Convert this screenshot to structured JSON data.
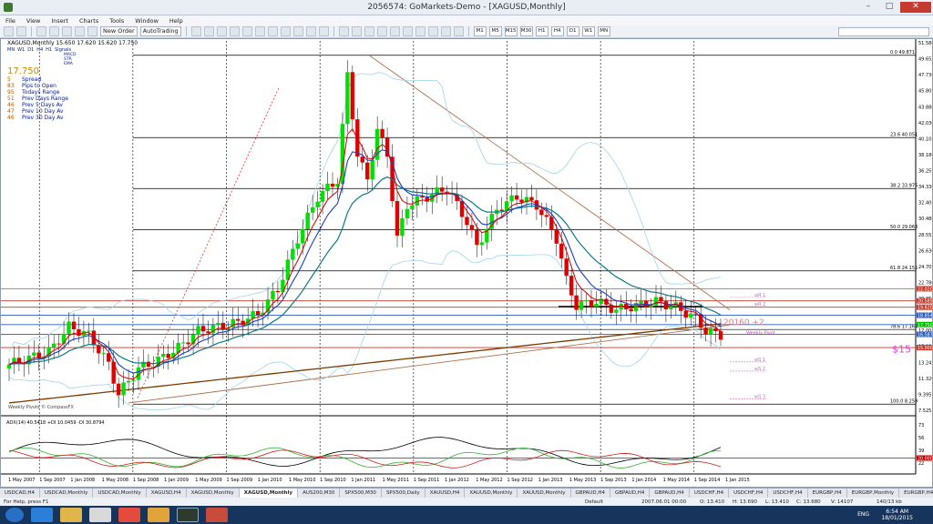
{
  "window": {
    "title": "2056574: GoMarkets-Demo - [XAGUSD,Monthly]"
  },
  "menu": [
    "File",
    "View",
    "Insert",
    "Charts",
    "Tools",
    "Window",
    "Help"
  ],
  "toolbar": {
    "new_order": "New Order",
    "autotrading": "AutoTrading",
    "timeframes": [
      "M1",
      "M5",
      "M15",
      "M30",
      "H1",
      "H4",
      "D1",
      "W1",
      "MN"
    ]
  },
  "chart": {
    "symbol_header": "XAGUSD,Monthly  15.650 17.620 15.620 17.750",
    "signal_tags": [
      "MN",
      "W1",
      "D1",
      "H4",
      "H1",
      "Signals"
    ],
    "signal_rows": [
      "MACD",
      "STR",
      "EMA"
    ],
    "big_price": "17.750",
    "info": [
      {
        "v": "5",
        "l": "Spread"
      },
      {
        "v": "83",
        "l": "Pips to Open"
      },
      {
        "v": "95",
        "l": "Todays Range"
      },
      {
        "v": "51",
        "l": "Prev Days Range"
      },
      {
        "v": "46",
        "l": "Prev 5 Days Av"
      },
      {
        "v": "47",
        "l": "Prev 10 Day Av"
      },
      {
        "v": "46",
        "l": "Prev 30 Day Av"
      }
    ],
    "fib_labels": [
      "0.0  49.871",
      "23.6  40.051",
      "38.2  33.976",
      "50.0  29.063",
      "61.8  24.155",
      "78.6  17.164",
      "100.0  8.259"
    ],
    "annotation": "20160 +2",
    "weekly_pivot_text": "Weekly Pivot",
    "dollar_label": "$15",
    "wr_labels": [
      "wR 1",
      "wR 2",
      "wS 1",
      "wS 2",
      "wS 3"
    ],
    "watermark": "Weekly Pivots © CompassFX",
    "price_axis": [
      "51.580",
      "49.655",
      "47.730",
      "45.805",
      "43.880",
      "42.030",
      "40.105",
      "38.180",
      "36.255",
      "34.330",
      "32.405",
      "30.480",
      "28.555",
      "26.630",
      "24.705",
      "22.780",
      "20.855",
      "18.930",
      "17.005",
      "15.080",
      "13.245",
      "11.320",
      "9.395",
      "7.525"
    ],
    "price_badges": [
      "22.020",
      "20.585",
      "19.820",
      "18.854",
      "17.750",
      "16.587",
      "15.000"
    ],
    "adx_label": "ADX(14) 40.5418 +DI 10.0459 -DI 30.8794",
    "adx_axis": [
      "73",
      "56",
      "39",
      "22"
    ],
    "adx_badge": "20.000",
    "time_axis": [
      "1 May 2007",
      "1 Sep 2007",
      "1 Jan 2008",
      "1 May 2008",
      "1 Sep 2008",
      "1 Jan 2009",
      "1 May 2009",
      "1 Sep 2009",
      "1 Jan 2010",
      "1 May 2010",
      "1 Sep 2010",
      "1 Jan 2011",
      "1 May 2011",
      "1 Sep 2011",
      "1 Jan 2012",
      "1 May 2012",
      "1 Sep 2012",
      "1 Jan 2013",
      "1 May 2013",
      "1 Sep 2013",
      "1 Jan 2014",
      "1 May 2014",
      "1 Sep 2014",
      "1 Jan 2015"
    ],
    "colors": {
      "bull": "#00e000",
      "bear": "#e00000",
      "ema_fast": "#d40000",
      "ema_slow": "#1a3cc8",
      "ema_long": "#0b7a86",
      "bands": "#9fd5e8",
      "ma_long": "#7a3b00"
    }
  },
  "tabs": [
    "USDCAD,H4",
    "USDCAD,Monthly",
    "USDCAD,Monthly",
    "XAGUSD,H4",
    "XAGUSD,Monthly",
    "XAGUSD,Monthly",
    "AUS200,M30",
    "SPX500,M30",
    "SPX500,Daily",
    "XAUUSD,H4",
    "XAUUSD,Monthly",
    "XAUUSD,Monthly",
    "GBPAUD,H4",
    "GBPAUD,H4",
    "GBPAUD,H4",
    "USDCHF,H4",
    "USDCHF,H4",
    "USDCHF,H4",
    "EURGBP,H4",
    "EURGBP,Monthly",
    "EURGBP,H4"
  ],
  "active_tab": 5,
  "status": {
    "help": "For Help, press F1",
    "profile": "Default",
    "time": "2007.06.01 00:00",
    "open": "O: 13.410",
    "high": "H: 13.690",
    "low": "L: 13.410",
    "close": "C: 13.680",
    "volume": "V: 14107",
    "conn": "140/13 kb"
  },
  "taskbar": {
    "lang": "ENG",
    "time": "6:54 AM",
    "date": "18/01/2015"
  }
}
